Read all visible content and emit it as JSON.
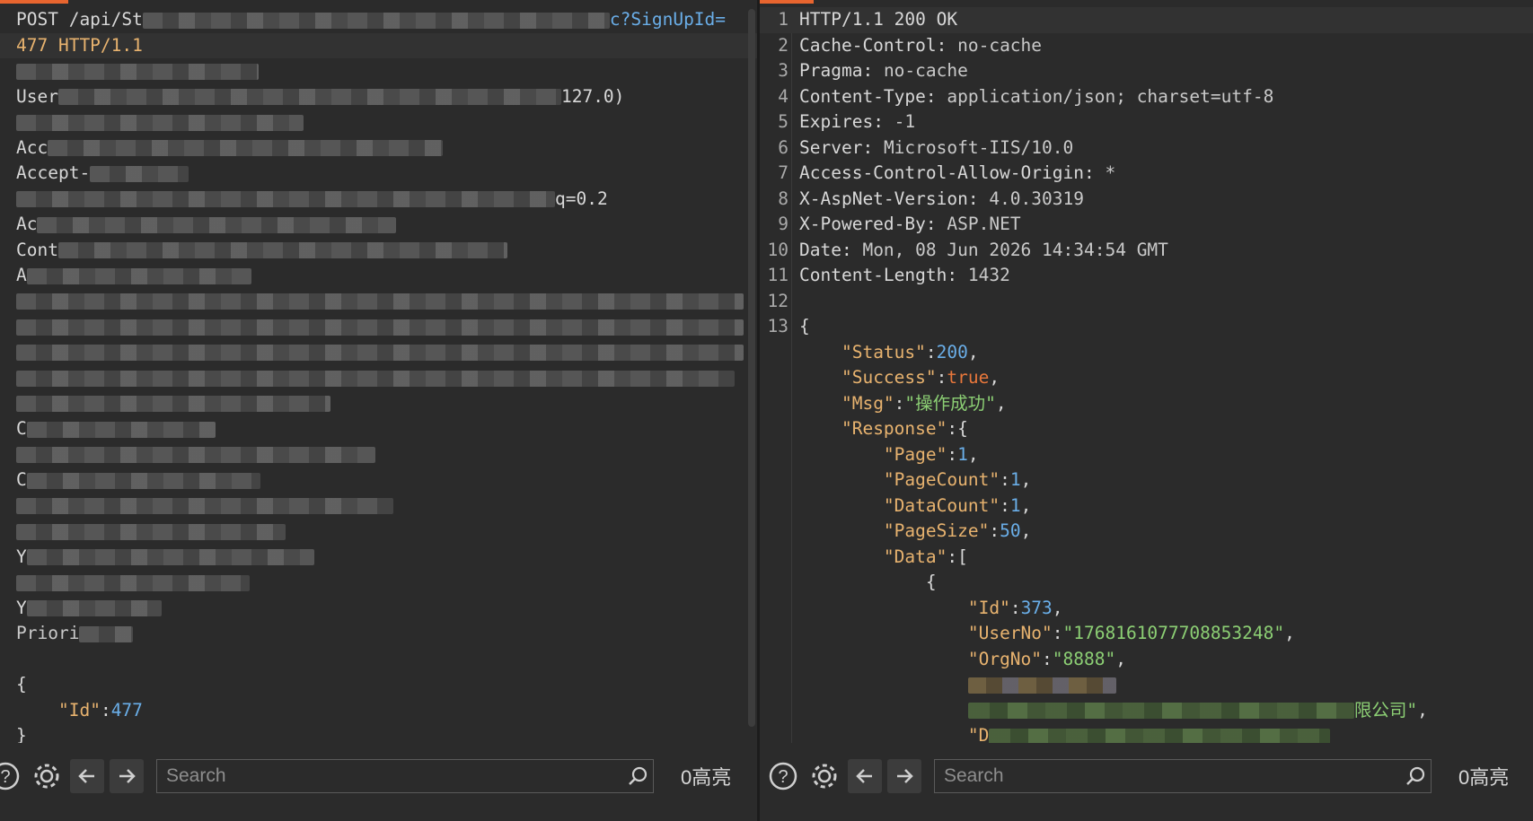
{
  "request": {
    "first_line_method": "POST /api/St",
    "first_line_tail": "c?SignUpId=",
    "second_line": "477 HTTP/1.1",
    "line_user": "User",
    "line_user_tail": "127.0)",
    "line_acc": "Acc",
    "line_accept": "Accept-",
    "line_q": "q=0.2",
    "line_ac2": "Ac",
    "line_cont": "Cont",
    "line_a3": "A",
    "line_c1": "C",
    "line_c2": "C",
    "line_y1": "Y",
    "line_y2": "Y",
    "line_pri": "Priori",
    "brace_open": "{",
    "body_key": "\"Id\"",
    "body_colon": ":",
    "body_value": "477",
    "brace_close": "}"
  },
  "response": {
    "lines": [
      {
        "num": "1",
        "text": "HTTP/1.1 200 OK"
      },
      {
        "num": "2",
        "key": "Cache-Control",
        "val": "no-cache"
      },
      {
        "num": "3",
        "key": "Pragma",
        "val": "no-cache"
      },
      {
        "num": "4",
        "key": "Content-Type",
        "val": "application/json; charset=utf-8"
      },
      {
        "num": "5",
        "key": "Expires",
        "val": "-1"
      },
      {
        "num": "6",
        "key": "Server",
        "val": "Microsoft-IIS/10.0"
      },
      {
        "num": "7",
        "key": "Access-Control-Allow-Origin",
        "val": "*"
      },
      {
        "num": "8",
        "key": "X-AspNet-Version",
        "val": "4.0.30319"
      },
      {
        "num": "9",
        "key": "X-Powered-By",
        "val": "ASP.NET"
      },
      {
        "num": "10",
        "key": "Date",
        "val": "Mon, 08 Jun 2026 14:34:54 GMT"
      },
      {
        "num": "11",
        "key": "Content-Length",
        "val": "1432"
      },
      {
        "num": "12"
      },
      {
        "num": "13",
        "text": "{"
      }
    ],
    "json": {
      "status_key": "\"Status\"",
      "status_val": "200",
      "success_key": "\"Success\"",
      "success_val": "true",
      "msg_key": "\"Msg\"",
      "msg_val": "\"操作成功\"",
      "response_key": "\"Response\"",
      "page_key": "\"Page\"",
      "page_val": "1",
      "pagecount_key": "\"PageCount\"",
      "pagecount_val": "1",
      "datacount_key": "\"DataCount\"",
      "datacount_val": "1",
      "pagesize_key": "\"PageSize\"",
      "pagesize_val": "50",
      "data_key": "\"Data\"",
      "id_key": "\"Id\"",
      "id_val": "373",
      "userno_key": "\"UserNo\"",
      "userno_val": "\"1768161077708853248\"",
      "orgno_key": "\"OrgNo\"",
      "orgno_val": "\"8888\"",
      "partial_tail": "限公司\"",
      "partial_start": "\"D"
    }
  },
  "toolbar": {
    "search_placeholder": "Search",
    "highlight_count_left": "0高亮",
    "highlight_count_right": "0高亮"
  }
}
